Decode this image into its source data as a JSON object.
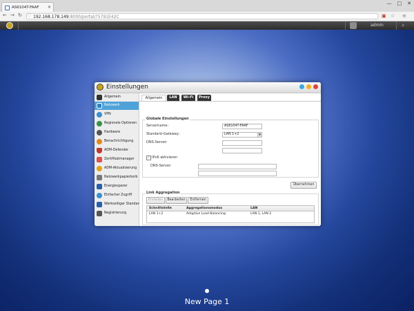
{
  "browser": {
    "tab_title": "AS6104T-FAAF",
    "url_host": "192.168.178.149",
    "url_rest": ":8000/portal/?5791E42C",
    "win_controls": [
      "—",
      "□",
      "✕"
    ]
  },
  "app_bar": {
    "username": "admin"
  },
  "window": {
    "title": "Einstellungen",
    "sidebar_items": [
      {
        "label": "Allgemein",
        "icon": "general-icon",
        "color": "#333333"
      },
      {
        "label": "Netzwerk",
        "icon": "network-icon",
        "color": "#2f7fc1"
      },
      {
        "label": "VPN",
        "icon": "vpn-icon",
        "color": "#3a8fd0"
      },
      {
        "label": "Regionale Optionen",
        "icon": "globe-icon",
        "color": "#3a8f4a"
      },
      {
        "label": "Hardware",
        "icon": "hardware-icon",
        "color": "#555555"
      },
      {
        "label": "Benachrichtigung",
        "icon": "notification-icon",
        "color": "#e08a1e"
      },
      {
        "label": "ADM-Defender",
        "icon": "shield-icon",
        "color": "#c0392b"
      },
      {
        "label": "Zertifikatmanager",
        "icon": "certificate-icon",
        "color": "#d9534f"
      },
      {
        "label": "ADM-Aktualisierung",
        "icon": "update-icon",
        "color": "#e0a31e"
      },
      {
        "label": "Netzwerkpapierkorb",
        "icon": "trash-icon",
        "color": "#777777"
      },
      {
        "label": "Energiesparer",
        "icon": "energy-icon",
        "color": "#2a5fa8"
      },
      {
        "label": "Einfacher Zugriff",
        "icon": "easy-access-icon",
        "color": "#3a8fd0"
      },
      {
        "label": "Werkseitiger Standard",
        "icon": "factory-reset-icon",
        "color": "#2a5fa8"
      },
      {
        "label": "Registrierung",
        "icon": "registration-icon",
        "color": "#555555"
      }
    ],
    "active_index": 1,
    "tabs": [
      "Allgemein",
      "LAN",
      "Wi-Fi",
      "Proxy"
    ],
    "global_settings": {
      "legend": "Globale Einstellungen",
      "server_name_label": "Servername:",
      "server_name_value": "AS6104T-FAAF",
      "gateway_label": "Standard-Gateway:",
      "gateway_value": "LAN 1+2",
      "dns_label": "DNS-Server:",
      "ipv6_label": "IPv6 aktivieren",
      "ipv6_checked": true,
      "ipv6_dns_label": "DNS-Server:"
    },
    "apply_label": "Übernehmen",
    "link_aggregation": {
      "legend": "Link Aggregation",
      "buttons": [
        "Erstellen",
        "Bearbeiten",
        "Entfernen"
      ],
      "columns": [
        "Schnittstelle",
        "Aggregationsmodus",
        "LAN"
      ],
      "rows": [
        [
          "LAN 1+2",
          "Adaptive Load Balancing",
          "LAN 1, LAN 2"
        ]
      ]
    }
  },
  "desktop": {
    "page_label": "New Page 1"
  }
}
